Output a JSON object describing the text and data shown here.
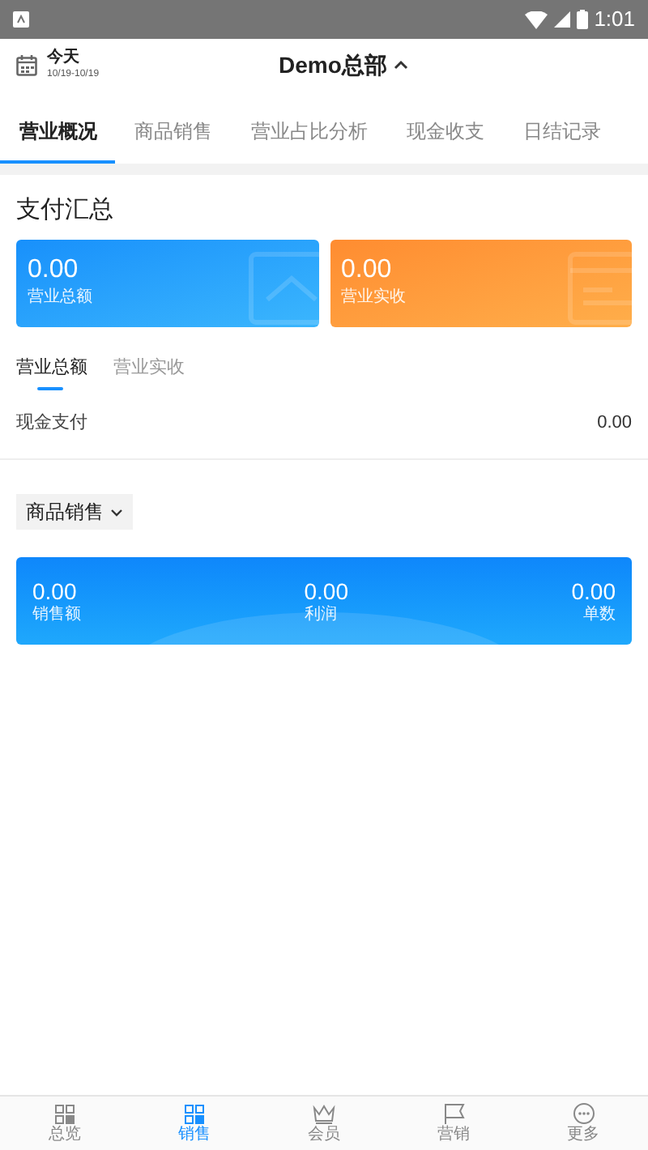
{
  "status_bar": {
    "time": "1:01"
  },
  "header": {
    "date_label": "今天",
    "date_range": "10/19-10/19",
    "store": "Demo总部",
    "expanded": true
  },
  "tabs": [
    {
      "label": "营业概况",
      "selected": true
    },
    {
      "label": "商品销售",
      "selected": false
    },
    {
      "label": "营业占比分析",
      "selected": false
    },
    {
      "label": "现金收支",
      "selected": false
    },
    {
      "label": "日结记录",
      "selected": false
    }
  ],
  "payment_summary": {
    "title": "支付汇总",
    "cards": [
      {
        "value": "0.00",
        "label": "营业总额",
        "kind": "blue"
      },
      {
        "value": "0.00",
        "label": "营业实收",
        "kind": "orange"
      }
    ],
    "subtabs": [
      {
        "label": "营业总额",
        "selected": true
      },
      {
        "label": "营业实收",
        "selected": false
      }
    ],
    "rows": [
      {
        "label": "现金支付",
        "value": "0.00"
      }
    ]
  },
  "sales": {
    "dropdown": "商品销售",
    "stats": [
      {
        "value": "0.00",
        "label": "销售额"
      },
      {
        "value": "0.00",
        "label": "利润"
      },
      {
        "value": "0.00",
        "label": "单数"
      }
    ]
  },
  "bottom_nav": [
    {
      "label": "总览",
      "kind": "grid",
      "selected": false
    },
    {
      "label": "销售",
      "kind": "grid",
      "selected": true
    },
    {
      "label": "会员",
      "kind": "crown",
      "selected": false
    },
    {
      "label": "营销",
      "kind": "flag",
      "selected": false
    },
    {
      "label": "更多",
      "kind": "more",
      "selected": false
    }
  ]
}
